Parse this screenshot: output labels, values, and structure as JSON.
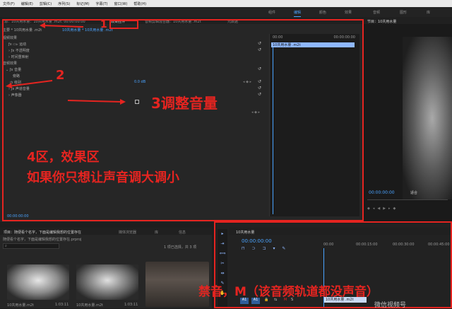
{
  "menu": [
    "文件(F)",
    "编辑(E)",
    "剪辑(C)",
    "序列(S)",
    "标记(M)",
    "字幕(T)",
    "窗口(W)",
    "帮助(H)"
  ],
  "workspace_tabs": [
    "组件",
    "编辑",
    "颜色",
    "效果",
    "音频",
    "图形",
    "库"
  ],
  "effect_controls": {
    "tabs": {
      "source": "源：10共用水量：10共用水量 .m2t: 00:00:00:00",
      "effect": "效果控件",
      "mixer": "音频剪辑混合器：10共用水量 .m2t",
      "metadata": "元数据"
    },
    "header": {
      "master": "主要 * 10共用水量 .m2t",
      "clip": "10共用水量 * 10共用水量 .m2t"
    },
    "timecode_start": "00:00",
    "timecode_end": "00:00:00:00",
    "clip_bar": "10共用水量 .m2t",
    "video_effects": "视频效果",
    "motion": "运动",
    "opacity": "不透明度",
    "time_remap": "时间重映射",
    "audio_effects": "音频效果",
    "volume": "音量",
    "bypass": "旁路",
    "level": "级别",
    "level_value": "0.0 dB",
    "channel_volume": "声道音量",
    "panner": "声像器",
    "playhead_time": "00:00:00:00"
  },
  "program": {
    "title": "节目：10共用水量",
    "timecode": "00:00:00:00",
    "fit": "适合"
  },
  "project": {
    "tabs": {
      "project": "项目：随便看个名字，下面是编辑我想的位置存在",
      "media_browser": "媒体浏览器",
      "library": "库",
      "info": "信息"
    },
    "path": "随便看个名字，下面是编辑我想的位置存在.prproj",
    "count": "1 项已选择，共 3 项",
    "items": [
      {
        "name": "10共用水量.m2t",
        "duration": "1:03:11"
      },
      {
        "name": "10共用水量.m2t",
        "duration": "1:03:11"
      },
      {
        "name": "",
        "duration": ""
      }
    ]
  },
  "timeline": {
    "title": "10共用水量",
    "timecode": "00:00:00:00",
    "ruler": [
      "00:00",
      "00:00:15:00",
      "00:00:30:00",
      "00:00:45:00"
    ],
    "clip": "10共用水量 .m2t"
  },
  "annotations": {
    "n1": "1",
    "n2": "2",
    "n3": "3调整音量",
    "area4_line1": "4区，效果区",
    "area4_line2": "如果你只想让声音调大调小",
    "mute": "禁音，M（该音频轨道都没声音）",
    "watermark": "微信视频号"
  },
  "colors": {
    "accent": "#4aa3ff",
    "annotation": "#e52420",
    "clip": "#8fb8ff"
  }
}
